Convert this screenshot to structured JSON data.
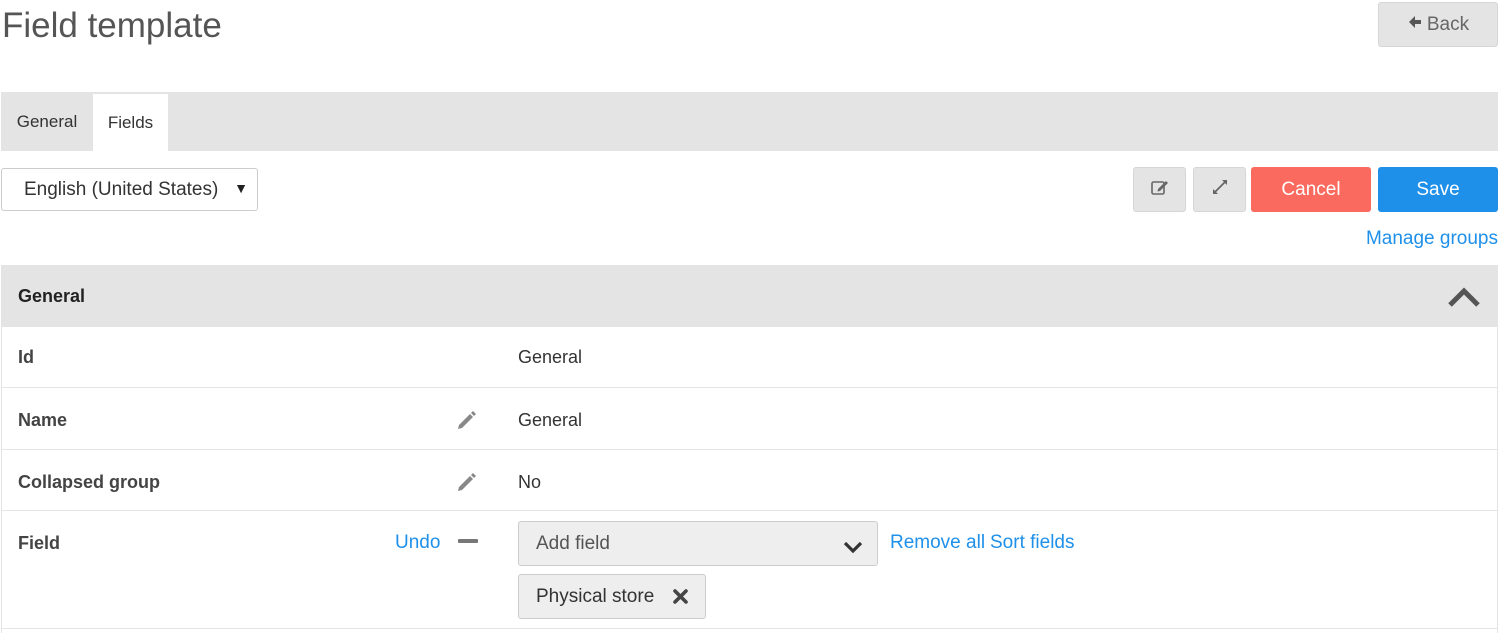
{
  "header": {
    "title": "Field template",
    "back_label": "Back"
  },
  "tabs": [
    {
      "label": "General"
    },
    {
      "label": "Fields"
    }
  ],
  "toolbar": {
    "language": "English (United States)",
    "cancel_label": "Cancel",
    "save_label": "Save",
    "manage_groups_label": "Manage groups"
  },
  "group": {
    "title": "General",
    "rows": [
      {
        "label": "Id",
        "value": "General"
      },
      {
        "label": "Name",
        "value": "General"
      },
      {
        "label": "Collapsed group",
        "value": "No"
      }
    ],
    "field_row": {
      "label": "Field",
      "undo_label": "Undo",
      "add_field_placeholder": "Add field",
      "remove_all_label": "Remove all",
      "sort_fields_label": "Sort fields",
      "chips": [
        {
          "label": "Physical store"
        }
      ]
    }
  },
  "colors": {
    "accent": "#1e90ea",
    "cancel": "#fa6a5e",
    "panel_gray": "#e4e4e4"
  },
  "icons": {
    "back": "arrow-left-icon",
    "edit": "edit-icon",
    "expand": "expand-icon",
    "collapse": "chevron-up-icon",
    "pencil": "pencil-icon",
    "minus": "minus-icon",
    "dropdown": "chevron-down-icon",
    "remove": "close-icon"
  }
}
